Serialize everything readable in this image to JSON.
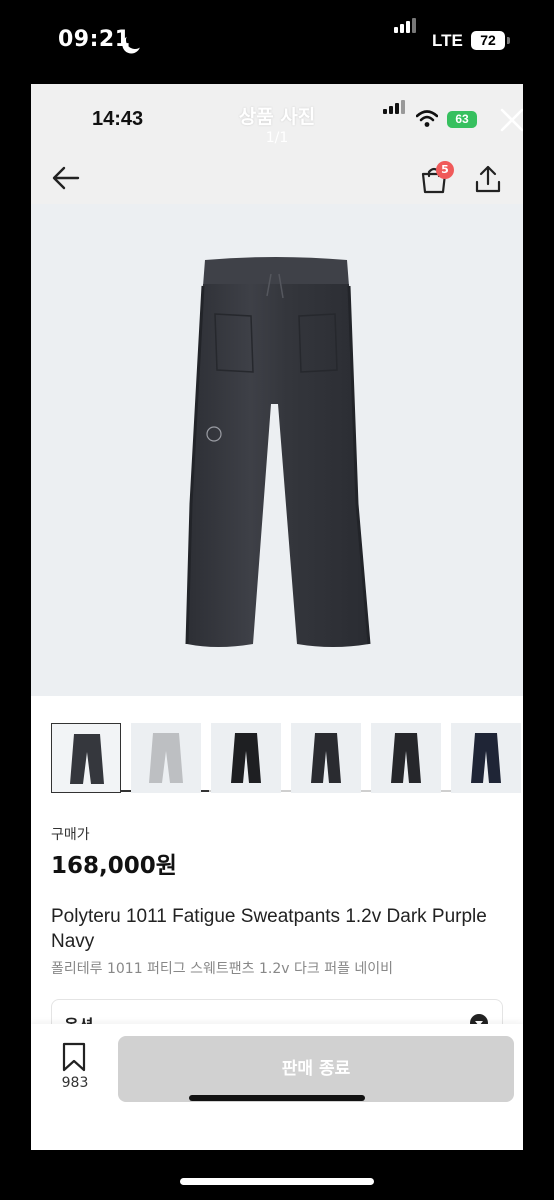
{
  "phone_status": {
    "time": "09:21",
    "network": "LTE",
    "battery": "72"
  },
  "app_status": {
    "time": "14:43",
    "battery": "63"
  },
  "viewer": {
    "title": "상품 사진",
    "counter": "1/1"
  },
  "header": {
    "cart_badge": "5"
  },
  "gallery": {
    "progress": 0.35,
    "thumbnail_count": 6
  },
  "product": {
    "price_label": "구매가",
    "price": "168,000원",
    "title_en": "Polyteru 1011 Fatigue Sweatpants 1.2v Dark Purple Navy",
    "title_ko": "폴리테루 1011 퍼티그 스웨트팬츠 1.2v 다크 퍼플 네이비"
  },
  "option": {
    "label": "옵션"
  },
  "bottom": {
    "bookmark_count": "983",
    "cta_label": "판매 종료"
  },
  "colors": {
    "cta_disabled": "#d1d1d1",
    "badge": "#f05a5a",
    "battery_green": "#37c05f"
  }
}
